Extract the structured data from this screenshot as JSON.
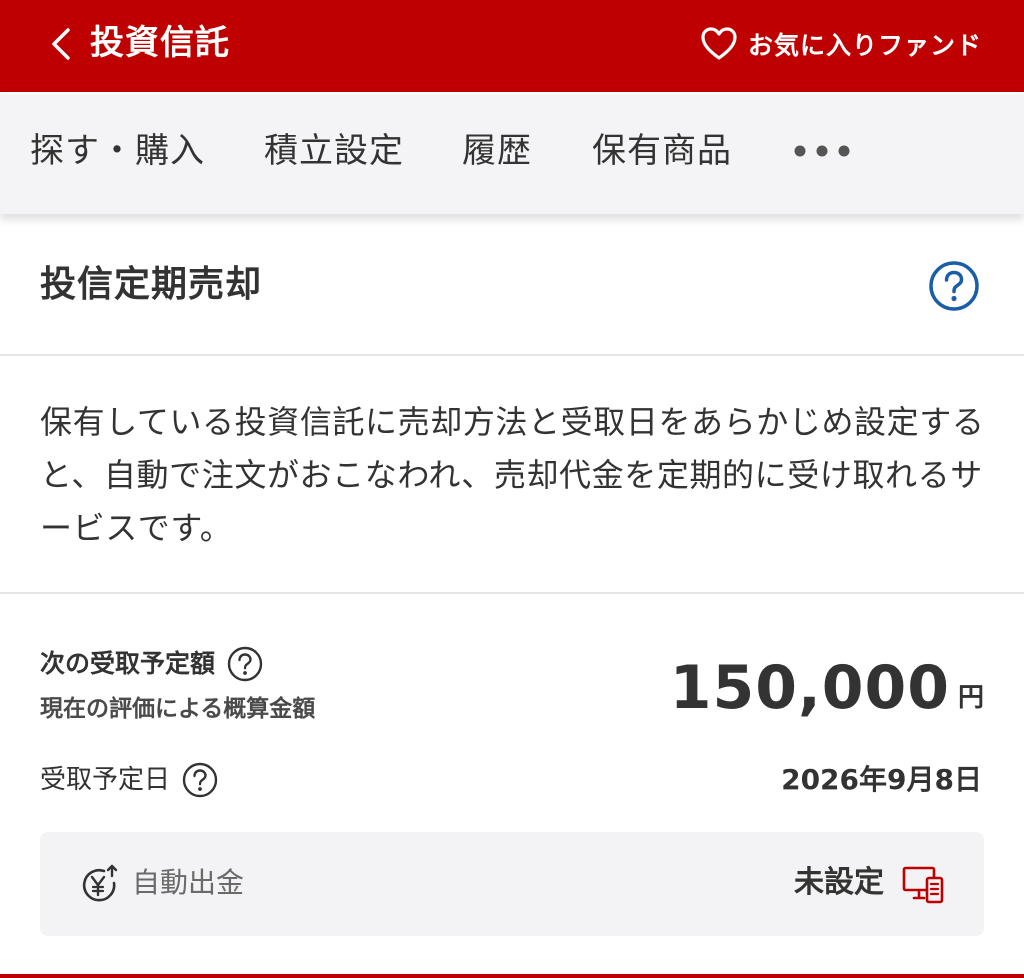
{
  "header": {
    "title": "投資信託",
    "favorites_label": "お気に入りファンド"
  },
  "tabs": [
    {
      "label": "探す・購入"
    },
    {
      "label": "積立設定"
    },
    {
      "label": "履歴"
    },
    {
      "label": "保有商品"
    }
  ],
  "section": {
    "title": "投信定期売却",
    "description": "保有している投資信託に売却方法と受取日をあらかじめ設定すると、自動で注文がおこなわれ、売却代金を定期的に受け取れるサービスです。"
  },
  "amount": {
    "label": "次の受取予定額",
    "sub_label": "現在の評価による概算金額",
    "value": "150,000",
    "unit": "円"
  },
  "date": {
    "label": "受取予定日",
    "value": "2026年9月8日"
  },
  "auto_withdrawal": {
    "label": "自動出金",
    "status": "未設定"
  },
  "colors": {
    "brand_red": "#bf0000",
    "help_blue": "#1a5ea8",
    "text_dark": "#333333",
    "panel_gray": "#f3f3f5"
  },
  "icons": {
    "back": "chevron-left-icon",
    "favorite": "heart-icon",
    "more": "more-horizontal-icon",
    "help": "help-circle-icon",
    "auto_withdrawal": "yen-coin-icon",
    "device": "pc-smartphone-icon"
  }
}
